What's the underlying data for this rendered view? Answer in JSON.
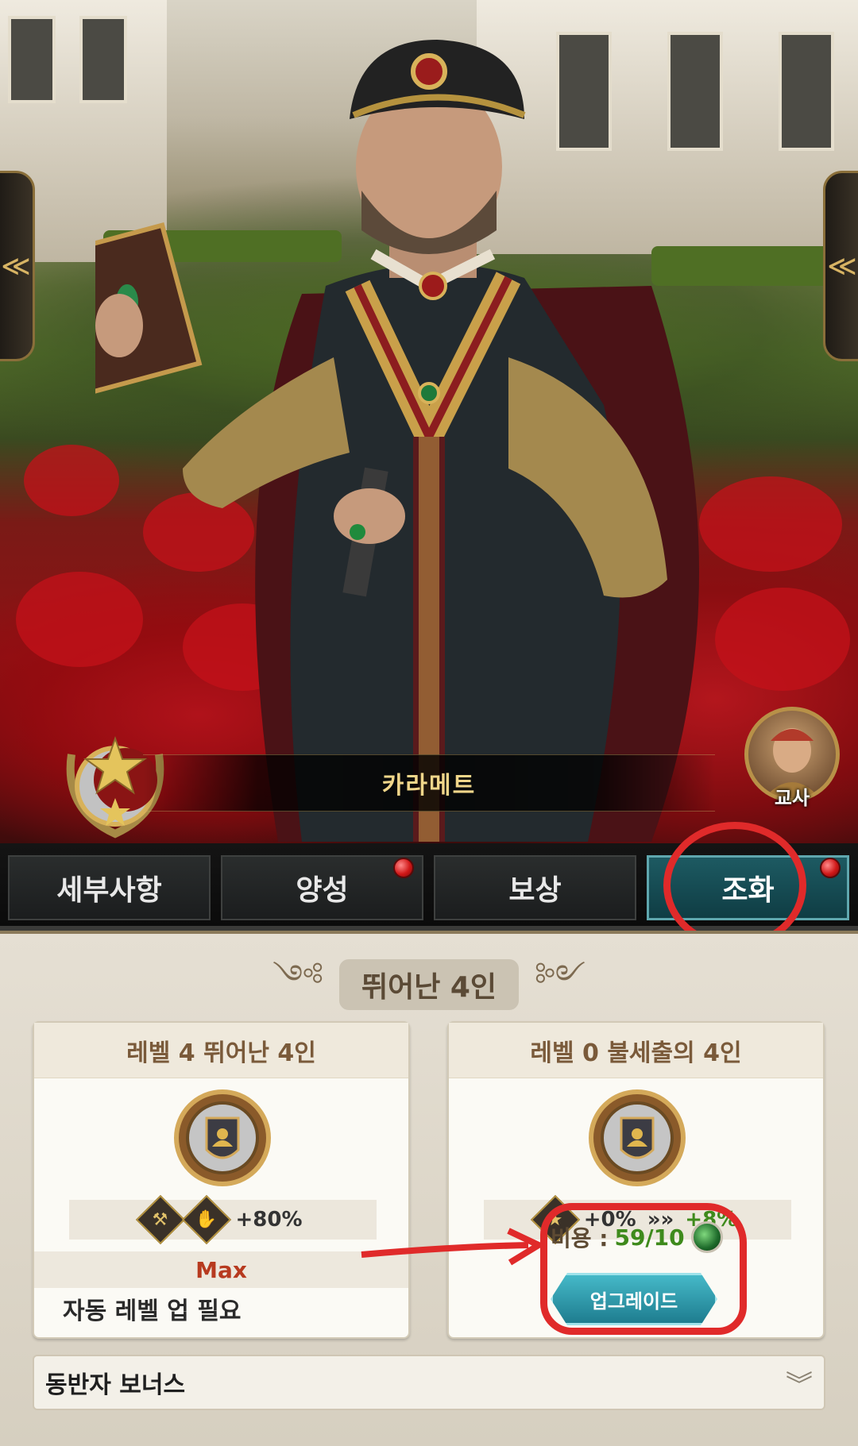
{
  "character": {
    "name": "카라메트",
    "role_label": "교사"
  },
  "tabs": [
    {
      "label": "세부사항",
      "active": false,
      "badge": false
    },
    {
      "label": "양성",
      "active": false,
      "badge": true
    },
    {
      "label": "보상",
      "active": false,
      "badge": false
    },
    {
      "label": "조화",
      "active": true,
      "badge": true
    }
  ],
  "panel": {
    "title": "뛰어난 4인",
    "left_card": {
      "header": "레벨 4 뛰어난 4인",
      "bonus": "+80%",
      "status": "Max",
      "note": "자동 레벨 업 필요"
    },
    "right_card": {
      "header": "레벨 0 불세출의 4인",
      "bonus_current": "+0%",
      "bonus_next": "+8%",
      "cost_label": "비용 :",
      "cost_value": "59/10",
      "upgrade_label": "업그레이드"
    },
    "companion_bonus": "동반자 보너스"
  },
  "icons": {
    "left_arrow": "chevron-left-icon",
    "right_arrow": "chevron-left-icon",
    "expand": "double-chevron-down-icon"
  },
  "colors": {
    "active_tab": "#1d5a62",
    "bonus_green": "#3e8a1c",
    "max_red": "#b73a1f",
    "annotation_red": "#e02a2a"
  }
}
